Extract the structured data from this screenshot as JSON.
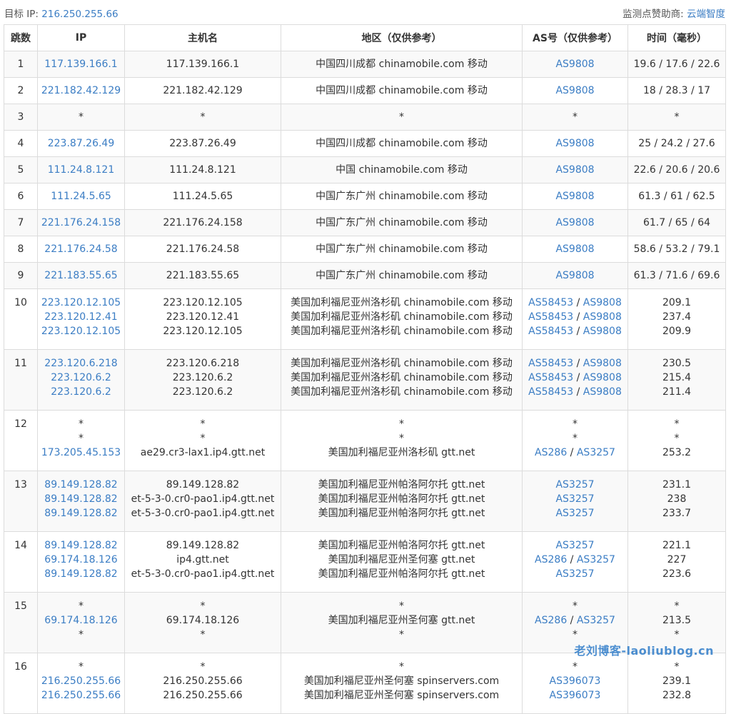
{
  "header": {
    "target_label": "目标 IP:",
    "target_ip": "216.250.255.66",
    "sponsor_label": "监测点赞助商:",
    "sponsor_name": "云端智度"
  },
  "columns": [
    "跳数",
    "IP",
    "主机名",
    "地区（仅供参考）",
    "AS号（仅供参考）",
    "时间（毫秒）"
  ],
  "rows": [
    {
      "hop": "1",
      "lines": [
        [
          "117.139.166.1",
          "117.139.166.1",
          "中国四川成都 chinamobile.com 移动",
          "AS9808",
          "19.6 / 17.6 / 22.6"
        ]
      ]
    },
    {
      "hop": "2",
      "lines": [
        [
          "221.182.42.129",
          "221.182.42.129",
          "中国四川成都 chinamobile.com 移动",
          "AS9808",
          "18 / 28.3 / 17"
        ]
      ]
    },
    {
      "hop": "3",
      "lines": [
        [
          "*",
          "*",
          "*",
          "*",
          "*"
        ]
      ]
    },
    {
      "hop": "4",
      "lines": [
        [
          "223.87.26.49",
          "223.87.26.49",
          "中国四川成都 chinamobile.com 移动",
          "AS9808",
          "25 / 24.2 / 27.6"
        ]
      ]
    },
    {
      "hop": "5",
      "lines": [
        [
          "111.24.8.121",
          "111.24.8.121",
          "中国 chinamobile.com 移动",
          "AS9808",
          "22.6 / 20.6 / 20.6"
        ]
      ]
    },
    {
      "hop": "6",
      "lines": [
        [
          "111.24.5.65",
          "111.24.5.65",
          "中国广东广州 chinamobile.com 移动",
          "AS9808",
          "61.3 / 61 / 62.5"
        ]
      ]
    },
    {
      "hop": "7",
      "lines": [
        [
          "221.176.24.158",
          "221.176.24.158",
          "中国广东广州 chinamobile.com 移动",
          "AS9808",
          "61.7 / 65 / 64"
        ]
      ]
    },
    {
      "hop": "8",
      "lines": [
        [
          "221.176.24.58",
          "221.176.24.58",
          "中国广东广州 chinamobile.com 移动",
          "AS9808",
          "58.6 / 53.2 / 79.1"
        ]
      ]
    },
    {
      "hop": "9",
      "lines": [
        [
          "221.183.55.65",
          "221.183.55.65",
          "中国广东广州 chinamobile.com 移动",
          "AS9808",
          "61.3 / 71.6 / 69.6"
        ]
      ]
    },
    {
      "hop": "10",
      "lines": [
        [
          "223.120.12.105",
          "223.120.12.105",
          "美国加利福尼亚州洛杉矶 chinamobile.com 移动",
          "AS58453 / AS9808",
          "209.1"
        ],
        [
          "223.120.12.41",
          "223.120.12.41",
          "美国加利福尼亚州洛杉矶 chinamobile.com 移动",
          "AS58453 / AS9808",
          "237.4"
        ],
        [
          "223.120.12.105",
          "223.120.12.105",
          "美国加利福尼亚州洛杉矶 chinamobile.com 移动",
          "AS58453 / AS9808",
          "209.9"
        ]
      ]
    },
    {
      "hop": "11",
      "lines": [
        [
          "223.120.6.218",
          "223.120.6.218",
          "美国加利福尼亚州洛杉矶 chinamobile.com 移动",
          "AS58453 / AS9808",
          "230.5"
        ],
        [
          "223.120.6.2",
          "223.120.6.2",
          "美国加利福尼亚州洛杉矶 chinamobile.com 移动",
          "AS58453 / AS9808",
          "215.4"
        ],
        [
          "223.120.6.2",
          "223.120.6.2",
          "美国加利福尼亚州洛杉矶 chinamobile.com 移动",
          "AS58453 / AS9808",
          "211.4"
        ]
      ]
    },
    {
      "hop": "12",
      "lines": [
        [
          "*",
          "*",
          "*",
          "*",
          "*"
        ],
        [
          "*",
          "*",
          "*",
          "*",
          "*"
        ],
        [
          "173.205.45.153",
          "ae29.cr3-lax1.ip4.gtt.net",
          "美国加利福尼亚州洛杉矶 gtt.net",
          "AS286 / AS3257",
          "253.2"
        ]
      ]
    },
    {
      "hop": "13",
      "lines": [
        [
          "89.149.128.82",
          "89.149.128.82",
          "美国加利福尼亚州帕洛阿尔托 gtt.net",
          "AS3257",
          "231.1"
        ],
        [
          "89.149.128.82",
          "et-5-3-0.cr0-pao1.ip4.gtt.net",
          "美国加利福尼亚州帕洛阿尔托 gtt.net",
          "AS3257",
          "238"
        ],
        [
          "89.149.128.82",
          "et-5-3-0.cr0-pao1.ip4.gtt.net",
          "美国加利福尼亚州帕洛阿尔托 gtt.net",
          "AS3257",
          "233.7"
        ]
      ]
    },
    {
      "hop": "14",
      "lines": [
        [
          "89.149.128.82",
          "89.149.128.82",
          "美国加利福尼亚州帕洛阿尔托 gtt.net",
          "AS3257",
          "221.1"
        ],
        [
          "69.174.18.126",
          "ip4.gtt.net",
          "美国加利福尼亚州圣何塞 gtt.net",
          "AS286 / AS3257",
          "227"
        ],
        [
          "89.149.128.82",
          "et-5-3-0.cr0-pao1.ip4.gtt.net",
          "美国加利福尼亚州帕洛阿尔托 gtt.net",
          "AS3257",
          "223.6"
        ]
      ]
    },
    {
      "hop": "15",
      "lines": [
        [
          "*",
          "*",
          "*",
          "*",
          "*"
        ],
        [
          "69.174.18.126",
          "69.174.18.126",
          "美国加利福尼亚州圣何塞 gtt.net",
          "AS286 / AS3257",
          "213.5"
        ],
        [
          "*",
          "*",
          "*",
          "*",
          "*"
        ]
      ]
    },
    {
      "hop": "16",
      "lines": [
        [
          "*",
          "*",
          "*",
          "*",
          "*"
        ],
        [
          "216.250.255.66",
          "216.250.255.66",
          "美国加利福尼亚州圣何塞 spinservers.com",
          "AS396073",
          "239.1"
        ],
        [
          "216.250.255.66",
          "216.250.255.66",
          "美国加利福尼亚州圣何塞 spinservers.com",
          "AS396073",
          "232.8"
        ]
      ]
    }
  ],
  "watermark": "老刘博客-laoliublog.cn"
}
